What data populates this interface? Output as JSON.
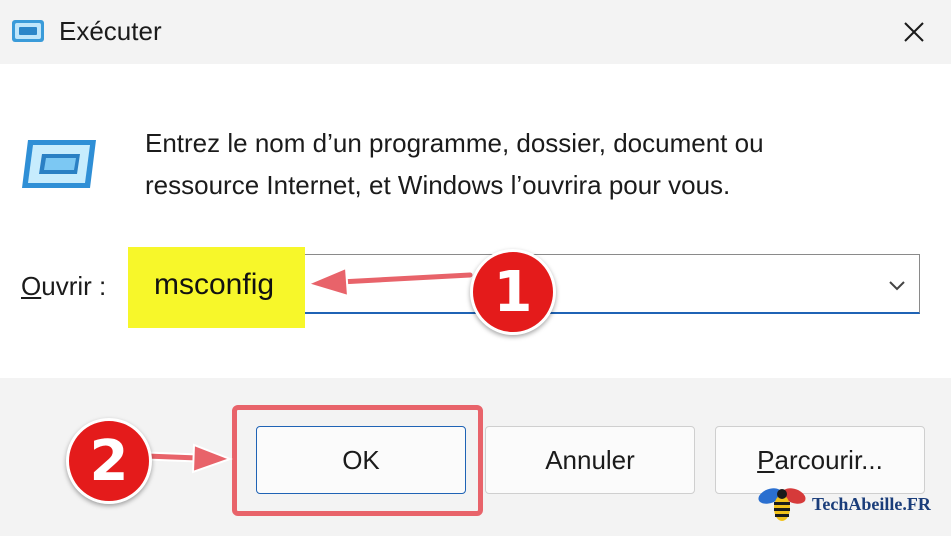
{
  "window": {
    "title": "Exécuter",
    "close_icon": "close-icon"
  },
  "dialog": {
    "icon": "run-icon",
    "description_line1": "Entrez le nom d’un programme, dossier, document ou",
    "description_line2": "ressource Internet, et Windows l’ouvrira pour vous.",
    "open_label_access_key": "O",
    "open_label_rest": "uvrir :",
    "open_value": "msconfig",
    "dropdown_icon": "chevron-down-icon"
  },
  "buttons": {
    "ok": "OK",
    "cancel": "Annuler",
    "browse_access_key": "P",
    "browse_rest": "arcourir..."
  },
  "annotations": {
    "step1": "1",
    "step2": "2",
    "highlight_color": "#f7f72a",
    "marker_color": "#e41b1b",
    "arrow_color": "#e8636a"
  },
  "watermark": {
    "brand": "TechAbeille",
    "suffix": ".FR"
  },
  "colors": {
    "accent": "#1f63b5",
    "titlebar_bg": "#f3f3f3",
    "content_bg": "#ffffff"
  }
}
